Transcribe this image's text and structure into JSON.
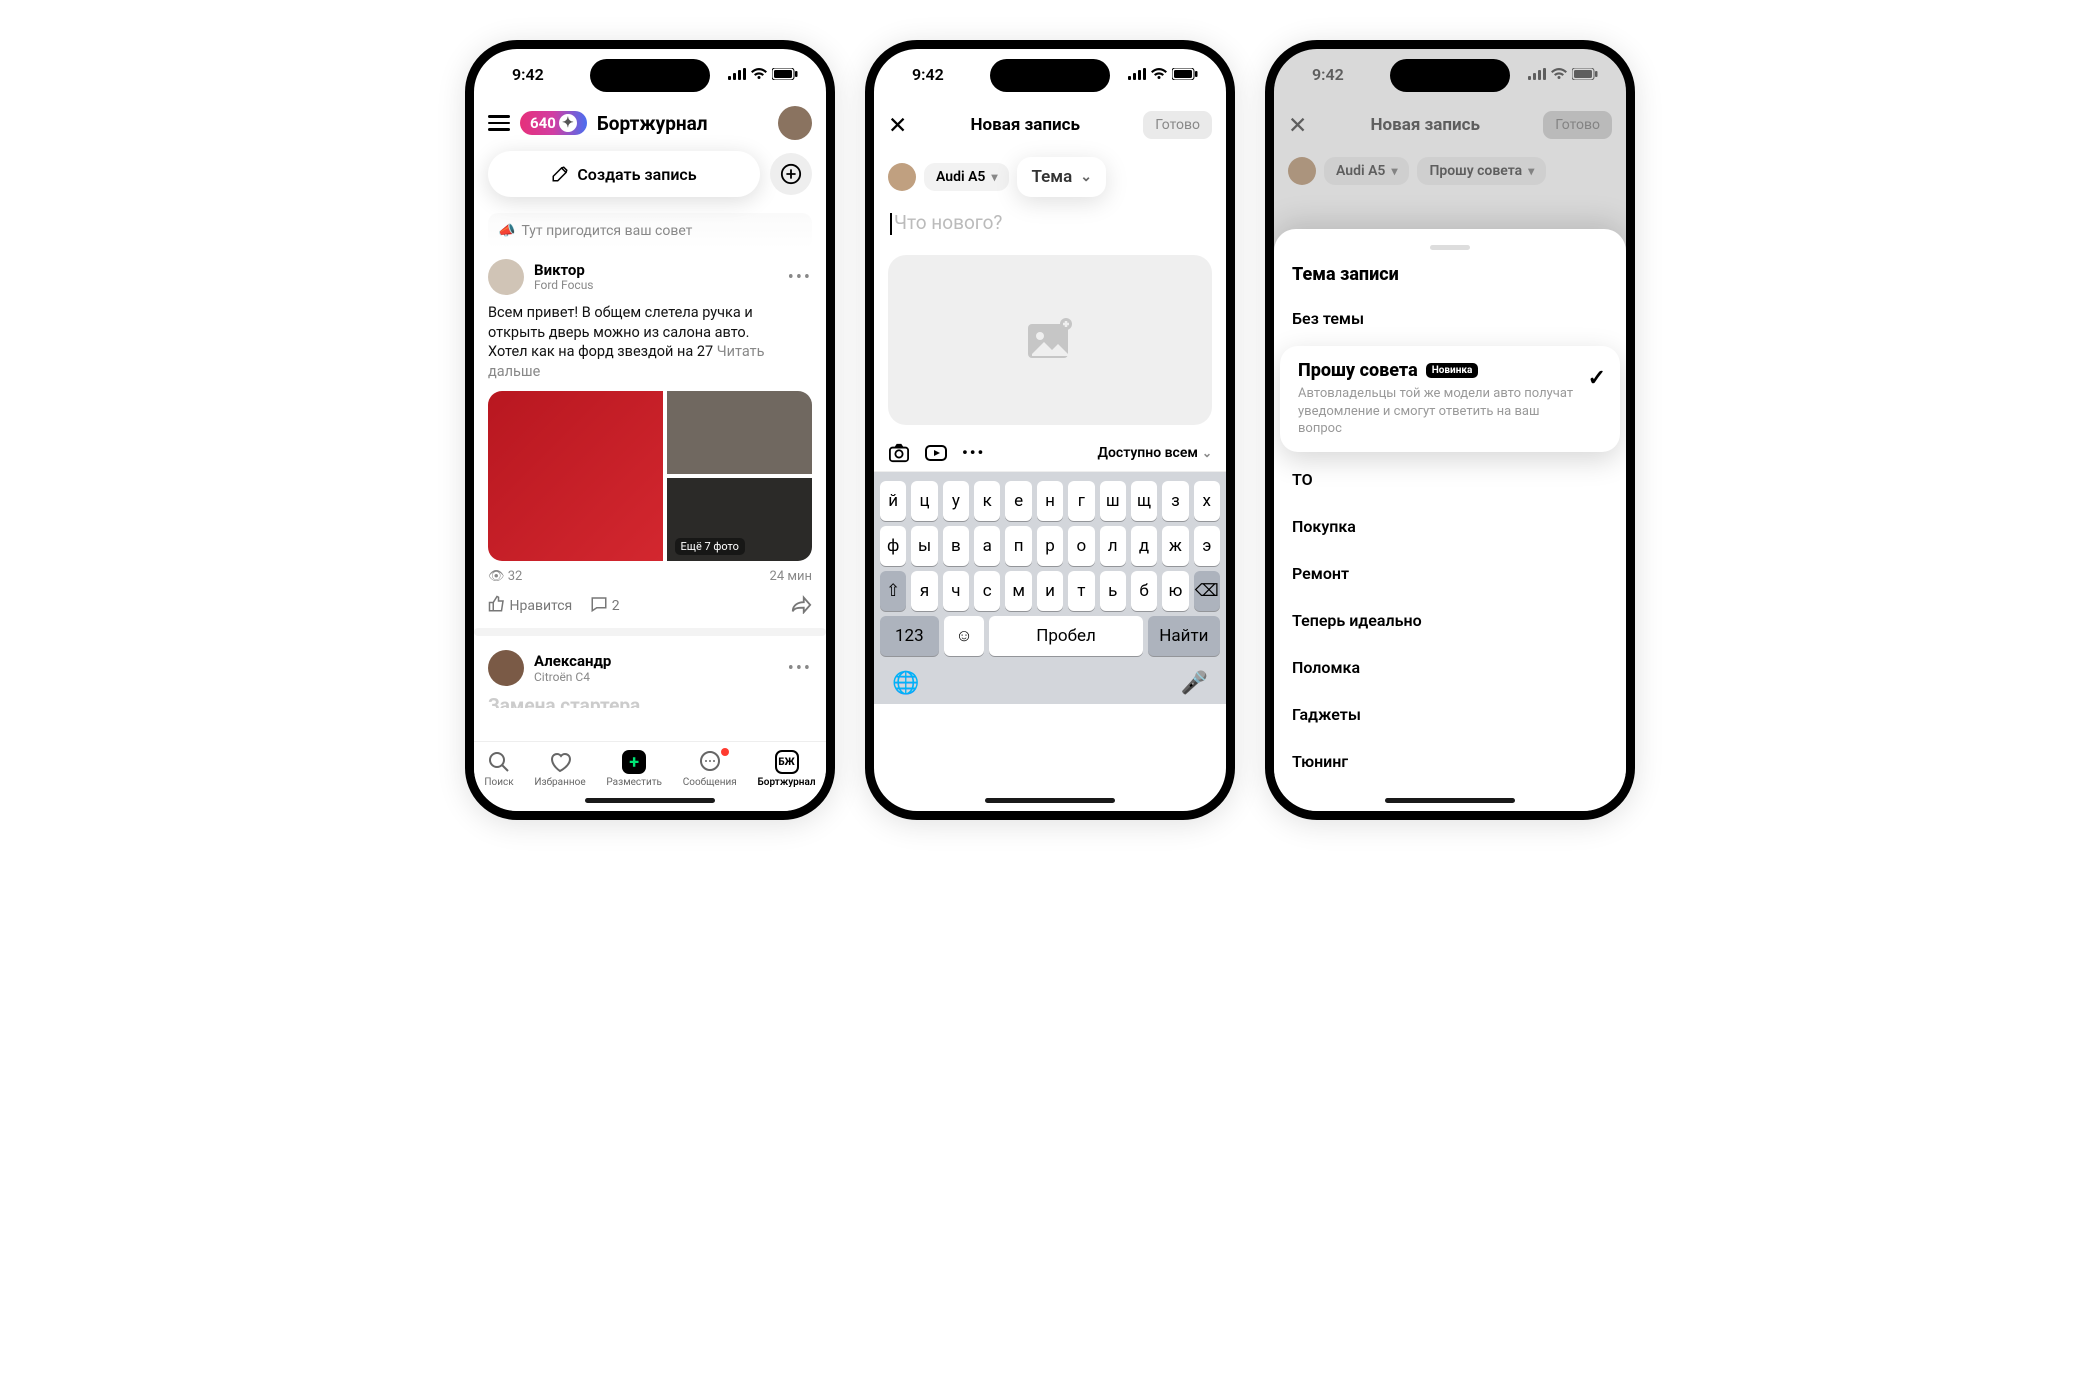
{
  "status_time": "9:42",
  "phone1": {
    "badge_count": "640",
    "title": "Бортжурнал",
    "create_label": "Создать запись",
    "hint": "Тут пригодится ваш совет",
    "post1": {
      "author": "Виктор",
      "car": "Ford Focus",
      "text_line1": "Всем привет! В общем слетела ручка и открыть дверь можно из салона авто.",
      "text_line2_a": "Хотел как на форд звездой на 27",
      "readmore": "Читать дальше",
      "more_photos": "Ещё 7 фото",
      "views": "32",
      "time_ago": "24 мин",
      "like_label": "Нравится",
      "comments": "2"
    },
    "post2": {
      "author": "Александр",
      "car": "Citroën C4",
      "title_peek": "Замена стартера"
    },
    "nav": [
      "Поиск",
      "Избранное",
      "Разместить",
      "Сообщения",
      "Бортжурнал"
    ]
  },
  "phone2": {
    "title": "Новая запись",
    "done": "Готово",
    "car_label": "Audi A5",
    "topic_placeholder": "Тема",
    "input_placeholder": "Что нового?",
    "visibility": "Доступно всем",
    "keyboard_rows": [
      [
        "й",
        "ц",
        "у",
        "к",
        "е",
        "н",
        "г",
        "ш",
        "щ",
        "з",
        "х"
      ],
      [
        "ф",
        "ы",
        "в",
        "а",
        "п",
        "р",
        "о",
        "л",
        "д",
        "ж",
        "э"
      ],
      [
        "я",
        "ч",
        "с",
        "м",
        "и",
        "т",
        "ь",
        "б",
        "ю"
      ]
    ],
    "key_123": "123",
    "key_space": "Пробел",
    "key_search": "Найти"
  },
  "phone3": {
    "title": "Новая запись",
    "done": "Готово",
    "car_label": "Audi A5",
    "topic_selected_short": "Прошу совета",
    "sheet_title": "Тема записи",
    "topics_before": [
      "Без темы"
    ],
    "selected": {
      "title": "Прошу совета",
      "new_tag": "Новинка",
      "desc": "Автовладельцы той же модели авто получат уведомление и смогут ответить на ваш вопрос"
    },
    "topics_after": [
      "ТО",
      "Покупка",
      "Ремонт",
      "Теперь идеально",
      "Поломка",
      "Гаджеты",
      "Тюнинг"
    ]
  }
}
